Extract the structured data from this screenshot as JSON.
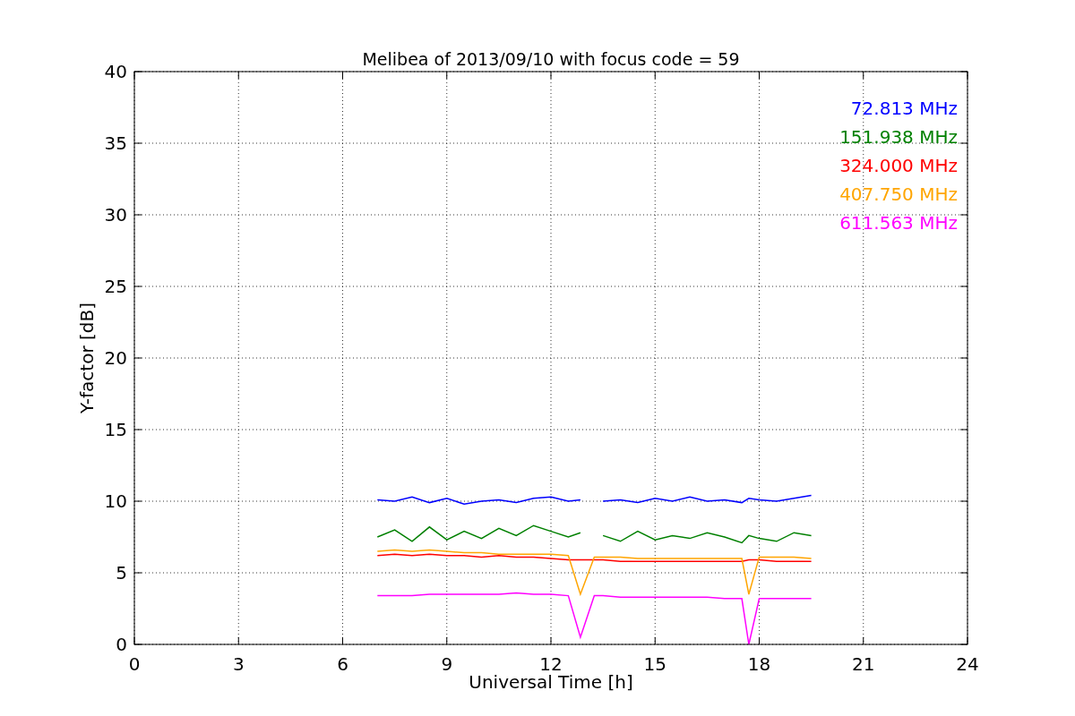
{
  "figure": {
    "chart_data": {
      "type": "line",
      "title": "Melibea of 2013/09/10 with focus code = 59",
      "xlabel": "Universal Time [h]",
      "ylabel": "Y-factor [dB]",
      "x": [
        7.0,
        7.5,
        8,
        8.5,
        9,
        9.5,
        10,
        10.5,
        11,
        11.5,
        12,
        12.5,
        12.85,
        13.25,
        13.5,
        14,
        14.5,
        15,
        15.5,
        16,
        16.5,
        17,
        17.5,
        17.7,
        18,
        18.5,
        19,
        19.5
      ],
      "series": [
        {
          "name": "72.813 MHz",
          "color": "#0000ff",
          "values": [
            10.1,
            10.0,
            10.3,
            9.9,
            10.2,
            9.8,
            10.0,
            10.1,
            9.9,
            10.2,
            10.3,
            10.0,
            10.1,
            null,
            10.0,
            10.1,
            9.9,
            10.2,
            10.0,
            10.3,
            10.0,
            10.1,
            9.9,
            10.2,
            10.1,
            10.0,
            10.2,
            10.4
          ]
        },
        {
          "name": "151.938 MHz",
          "color": "#008000",
          "values": [
            7.5,
            8.0,
            7.2,
            8.2,
            7.3,
            7.9,
            7.4,
            8.1,
            7.6,
            8.3,
            7.9,
            7.5,
            7.8,
            null,
            7.6,
            7.2,
            7.9,
            7.3,
            7.6,
            7.4,
            7.8,
            7.5,
            7.1,
            7.6,
            7.4,
            7.2,
            7.8,
            7.6
          ]
        },
        {
          "name": "324.000 MHz",
          "color": "#ff0000",
          "values": [
            6.2,
            6.3,
            6.2,
            6.3,
            6.2,
            6.2,
            6.1,
            6.2,
            6.1,
            6.1,
            6.0,
            5.9,
            5.9,
            5.9,
            5.9,
            5.8,
            5.8,
            5.8,
            5.8,
            5.8,
            5.8,
            5.8,
            5.8,
            5.9,
            5.9,
            5.8,
            5.8,
            5.8
          ]
        },
        {
          "name": "407.750 MHz",
          "color": "#ffa500",
          "values": [
            6.5,
            6.6,
            6.5,
            6.6,
            6.5,
            6.4,
            6.4,
            6.3,
            6.3,
            6.3,
            6.3,
            6.2,
            3.5,
            6.1,
            6.1,
            6.1,
            6.0,
            6.0,
            6.0,
            6.0,
            6.0,
            6.0,
            6.0,
            3.5,
            6.1,
            6.1,
            6.1,
            6.0
          ]
        },
        {
          "name": "611.563 MHz",
          "color": "#ff00ff",
          "values": [
            3.4,
            3.4,
            3.4,
            3.5,
            3.5,
            3.5,
            3.5,
            3.5,
            3.6,
            3.5,
            3.5,
            3.4,
            0.5,
            3.4,
            3.4,
            3.3,
            3.3,
            3.3,
            3.3,
            3.3,
            3.3,
            3.2,
            3.2,
            0,
            3.2,
            3.2,
            3.2,
            3.2
          ]
        }
      ],
      "grid": true,
      "xlim": [
        0,
        24
      ],
      "ylim": [
        0,
        40
      ],
      "xticks": [
        0,
        3,
        6,
        9,
        12,
        15,
        18,
        21,
        24
      ],
      "yticks": [
        0,
        5,
        10,
        15,
        20,
        25,
        30,
        35,
        40
      ]
    }
  }
}
